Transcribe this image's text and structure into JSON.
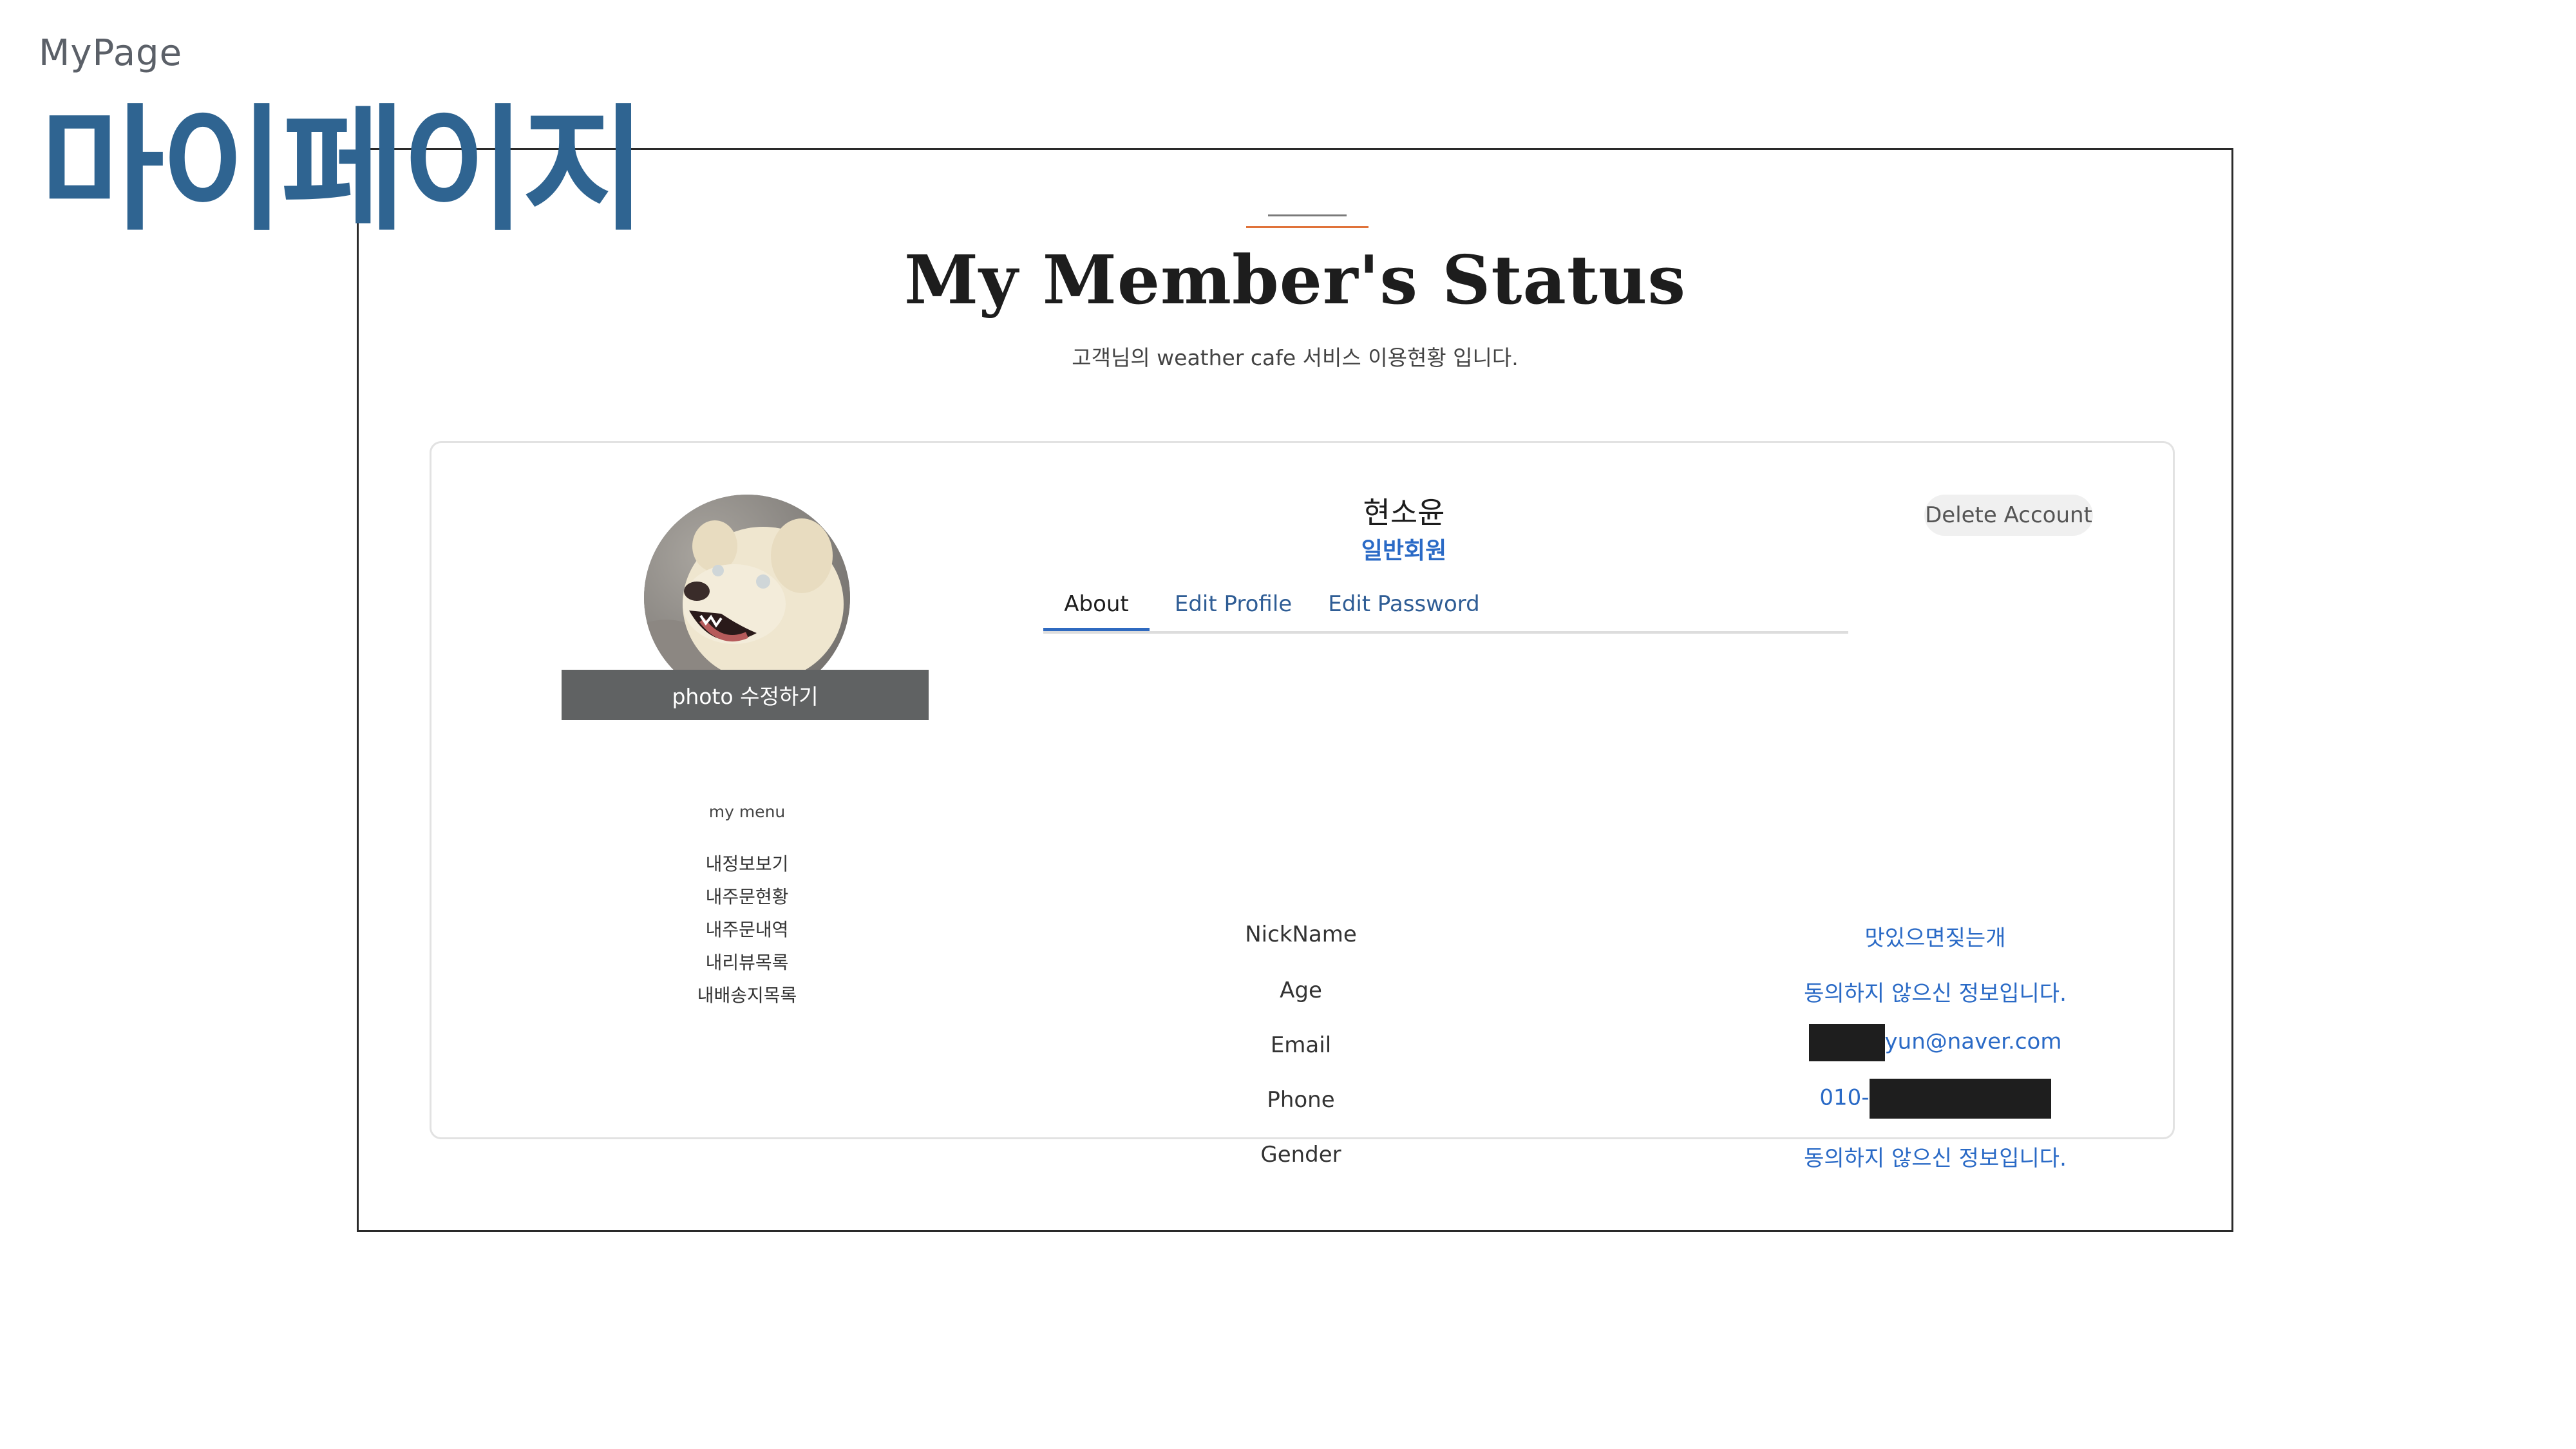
{
  "slide": {
    "label": "MyPage",
    "title": "마이페이지"
  },
  "page": {
    "title": "My Member's Status",
    "subtitle": "고객님의 weather cafe 서비스 이용현황 입니다."
  },
  "profile": {
    "photo_edit_label": "photo 수정하기",
    "name": "현소윤",
    "grade": "일반회원",
    "delete_label": "Delete Account"
  },
  "sidebar": {
    "heading": "my menu",
    "items": [
      "내정보보기",
      "내주문현황",
      "내주문내역",
      "내리뷰목록",
      "내배송지목록"
    ]
  },
  "tabs": [
    {
      "label": "About",
      "active": true
    },
    {
      "label": "Edit Profile",
      "active": false
    },
    {
      "label": "Edit Password",
      "active": false
    }
  ],
  "info": {
    "nickname_label": "NickName",
    "nickname_value": "맛있으면짖는개",
    "age_label": "Age",
    "age_value": "동의하지 않으신 정보입니다.",
    "email_label": "Email",
    "email_value": "yun@naver.com",
    "phone_label": "Phone",
    "phone_value": "010-",
    "gender_label": "Gender",
    "gender_value": "동의하지 않으신 정보입니다."
  },
  "colors": {
    "title_blue": "#2f6491",
    "link_blue": "#2a6ac6",
    "accent_orange": "#e0733a"
  }
}
